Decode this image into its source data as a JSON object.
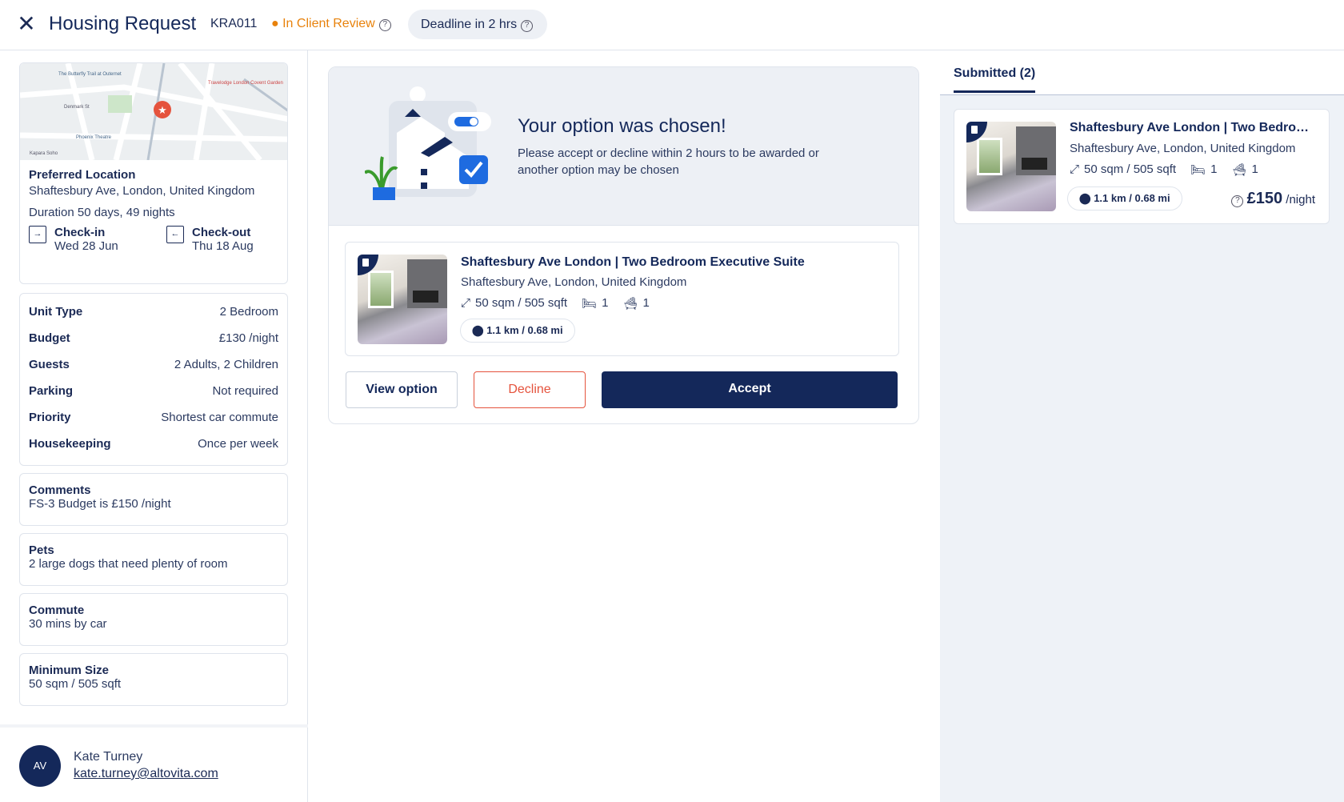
{
  "header": {
    "title": "Housing Request",
    "code": "KRA011",
    "status": "In Client Review",
    "deadline": "Deadline in 2 hrs"
  },
  "colors": {
    "navy": "#14285a",
    "status": "#e8820c",
    "decline": "#e5533d"
  },
  "request": {
    "preferred_location_label": "Preferred Location",
    "preferred_location": "Shaftesbury Ave, London, United Kingdom",
    "duration": "Duration 50 days, 49 nights",
    "checkin_label": "Check-in",
    "checkin": "Wed 28 Jun",
    "checkout_label": "Check-out",
    "checkout": "Thu 18 Aug",
    "details": [
      {
        "label": "Unit Type",
        "value": "2 Bedroom"
      },
      {
        "label": "Budget",
        "value": "£130 /night"
      },
      {
        "label": "Guests",
        "value": "2 Adults, 2 Children"
      },
      {
        "label": "Parking",
        "value": "Not required"
      },
      {
        "label": "Priority",
        "value": "Shortest car commute"
      },
      {
        "label": "Housekeeping",
        "value": "Once per week"
      }
    ],
    "notes": [
      {
        "label": "Comments",
        "value": "FS-3 Budget is £150 /night"
      },
      {
        "label": "Pets",
        "value": "2 large dogs that need plenty of room"
      },
      {
        "label": "Commute",
        "value": "30 mins by car"
      },
      {
        "label": "Minimum Size",
        "value": "50 sqm / 505 sqft"
      }
    ],
    "map_labels": [
      "The Butterfly Trail at Outernet",
      "Travelodge London Covent Garden",
      "Denmark St",
      "Phoenix Theatre",
      "Kapara Soho"
    ]
  },
  "user": {
    "name": "Kate Turney",
    "email": "kate.turney@altovita.com"
  },
  "banner": {
    "title": "Your option was chosen!",
    "text": "Please accept or decline within 2 hours to be awarded or another option may be chosen"
  },
  "option": {
    "title": "Shaftesbury Ave London | Two Bedroom Executive Suite",
    "address": "Shaftesbury Ave, London, United Kingdom",
    "size": "50 sqm / 505 sqft",
    "beds": "1",
    "baths": "1",
    "distance": "1.1 km / 0.68 mi"
  },
  "actions": {
    "view": "View option",
    "decline": "Decline",
    "accept": "Accept"
  },
  "submitted": {
    "tab": "Submitted (2)",
    "title": "Shaftesbury Ave London | Two Bedroom Executive Suite",
    "address": "Shaftesbury Ave, London, United Kingdom",
    "size": "50 sqm / 505 sqft",
    "beds": "1",
    "baths": "1",
    "distance": "1.1 km / 0.68 mi",
    "price": "£150",
    "price_unit": "/night"
  }
}
